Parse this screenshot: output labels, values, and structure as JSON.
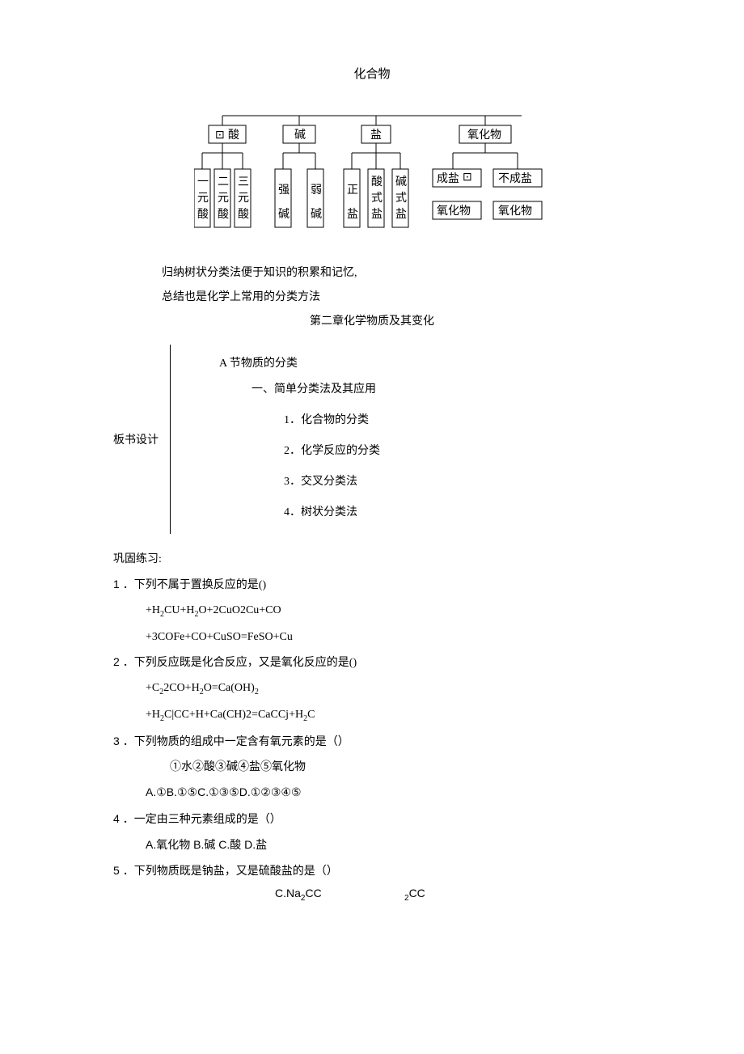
{
  "title_compound": "化合物",
  "tree": {
    "level1": [
      "酸",
      "碱",
      "盐",
      "氧化物"
    ],
    "acid_children": [
      "一元酸",
      "二元酸",
      "三元酸"
    ],
    "base_children": [
      "强碱",
      "弱碱"
    ],
    "salt_children": [
      "正盐",
      "酸式盐",
      "碱式盐"
    ],
    "oxide_children": [
      "成盐氧化物",
      "不成盐氧化物"
    ]
  },
  "summary1": "归纳树状分类法便于知识的积累和记忆,",
  "summary2": "总结也是化学上常用的分类方法",
  "chapter_title": "第二章化学物质及其变化",
  "bb": {
    "label": "板书设计",
    "row1": "A 节物质的分类",
    "row2": "一、简单分类法及其应用",
    "items": [
      "1．化合物的分类",
      "2．化学反应的分类",
      "3．交叉分类法",
      "4．树状分类法"
    ]
  },
  "ex_head": "巩固练习:",
  "q1": {
    "num": "1",
    "text": "．下列不属于置换反应的是()",
    "line1": "+H2CU+H2O+2CuO2Cu+CO",
    "line2": "+3COFe+CO+CuSO=FeSO+Cu"
  },
  "q2": {
    "num": "2",
    "text": "．下列反应既是化合反应，又是氧化反应的是()",
    "line1": "+C22CO+H2O=Ca(OH)2",
    "line2": "+H2C|CC+H+Ca(CH)2=CaCCj+H2C"
  },
  "q3": {
    "num": "3",
    "text": "．下列物质的组成中一定含有氧元素的是（）",
    "line1": "①水②酸③碱④盐⑤氧化物",
    "options": "A.①B.①⑤C.①③⑤D.①②③④⑤"
  },
  "q4": {
    "num": "4",
    "text": "．一定由三种元素组成的是（）",
    "options": "A.氧化物 B.碱 C.酸 D.盐"
  },
  "q5": {
    "num": "5",
    "text": "．下列物质既是钠盐，又是硫酸盐的是（）",
    "opt_c": "C.Na2CC",
    "opt_d": "2CC"
  }
}
